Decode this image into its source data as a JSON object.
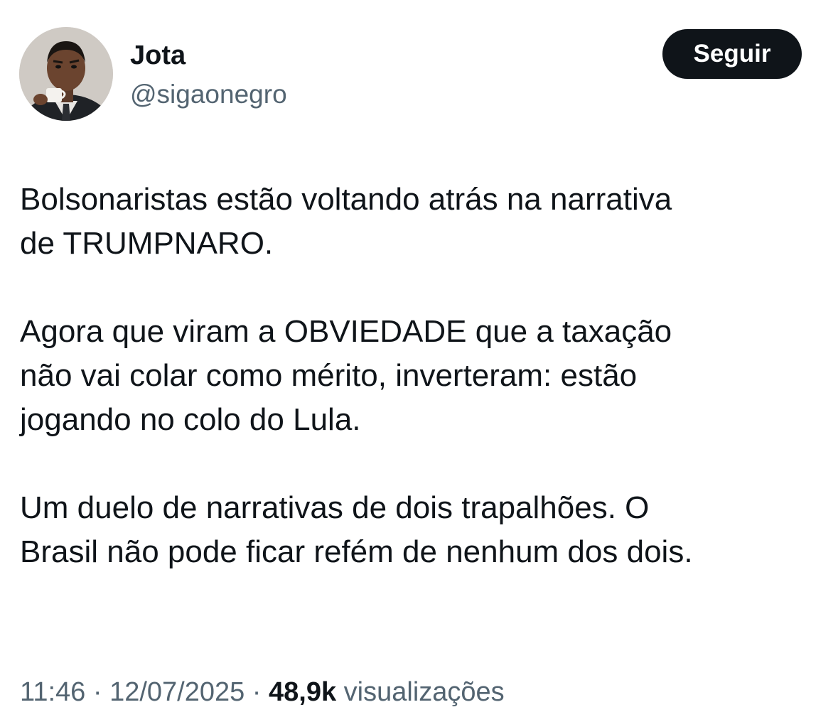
{
  "author": {
    "display_name": "Jota",
    "handle": "@sigaonegro"
  },
  "follow_button": {
    "label": "Seguir"
  },
  "tweet": {
    "paragraphs": [
      "Bolsonaristas estão voltando atrás na narrativa\nde TRUMPNARO.",
      "Agora que viram a OBVIEDADE que a taxação\nnão vai colar como mérito, inverteram: estão\njogando no colo do Lula.",
      "Um duelo de narrativas de dois trapalhões. O\nBrasil não pode ficar refém de nenhum dos dois."
    ]
  },
  "meta": {
    "time": "11:46",
    "separator": " · ",
    "date": "12/07/2025",
    "views_count": "48,9k",
    "views_label": " visualizações"
  },
  "colors": {
    "text_primary": "#0f1419",
    "text_secondary": "#536471",
    "button_bg": "#0f1419",
    "button_text": "#ffffff"
  }
}
